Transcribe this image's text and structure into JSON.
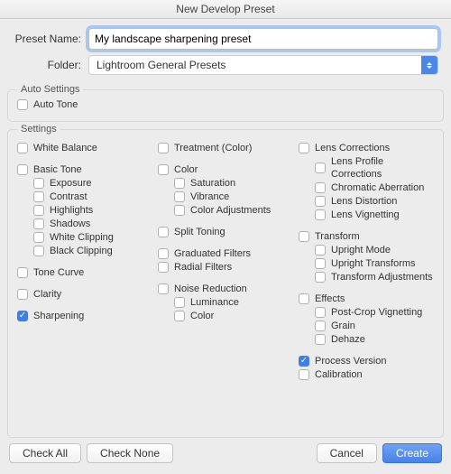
{
  "window": {
    "title": "New Develop Preset"
  },
  "form": {
    "preset_label": "Preset Name:",
    "preset_value": "My landscape sharpening preset",
    "folder_label": "Folder:",
    "folder_value": "Lightroom General Presets"
  },
  "auto": {
    "title": "Auto Settings",
    "auto_tone": "Auto Tone"
  },
  "settings": {
    "title": "Settings",
    "col1": {
      "white_balance": "White Balance",
      "basic_tone": "Basic Tone",
      "exposure": "Exposure",
      "contrast": "Contrast",
      "highlights": "Highlights",
      "shadows": "Shadows",
      "white_clipping": "White Clipping",
      "black_clipping": "Black Clipping",
      "tone_curve": "Tone Curve",
      "clarity": "Clarity",
      "sharpening": "Sharpening"
    },
    "col2": {
      "treatment": "Treatment (Color)",
      "color": "Color",
      "saturation": "Saturation",
      "vibrance": "Vibrance",
      "color_adjustments": "Color Adjustments",
      "split_toning": "Split Toning",
      "graduated_filters": "Graduated Filters",
      "radial_filters": "Radial Filters",
      "noise_reduction": "Noise Reduction",
      "luminance": "Luminance",
      "noise_color": "Color"
    },
    "col3": {
      "lens_corrections": "Lens Corrections",
      "lens_profile": "Lens Profile Corrections",
      "chromatic": "Chromatic Aberration",
      "lens_distortion": "Lens Distortion",
      "lens_vignetting": "Lens Vignetting",
      "transform": "Transform",
      "upright_mode": "Upright Mode",
      "upright_transforms": "Upright Transforms",
      "transform_adjustments": "Transform Adjustments",
      "effects": "Effects",
      "post_crop": "Post-Crop Vignetting",
      "grain": "Grain",
      "dehaze": "Dehaze",
      "process_version": "Process Version",
      "calibration": "Calibration"
    }
  },
  "buttons": {
    "check_all": "Check All",
    "check_none": "Check None",
    "cancel": "Cancel",
    "create": "Create"
  },
  "checked": {
    "sharpening": true,
    "process_version": true
  }
}
